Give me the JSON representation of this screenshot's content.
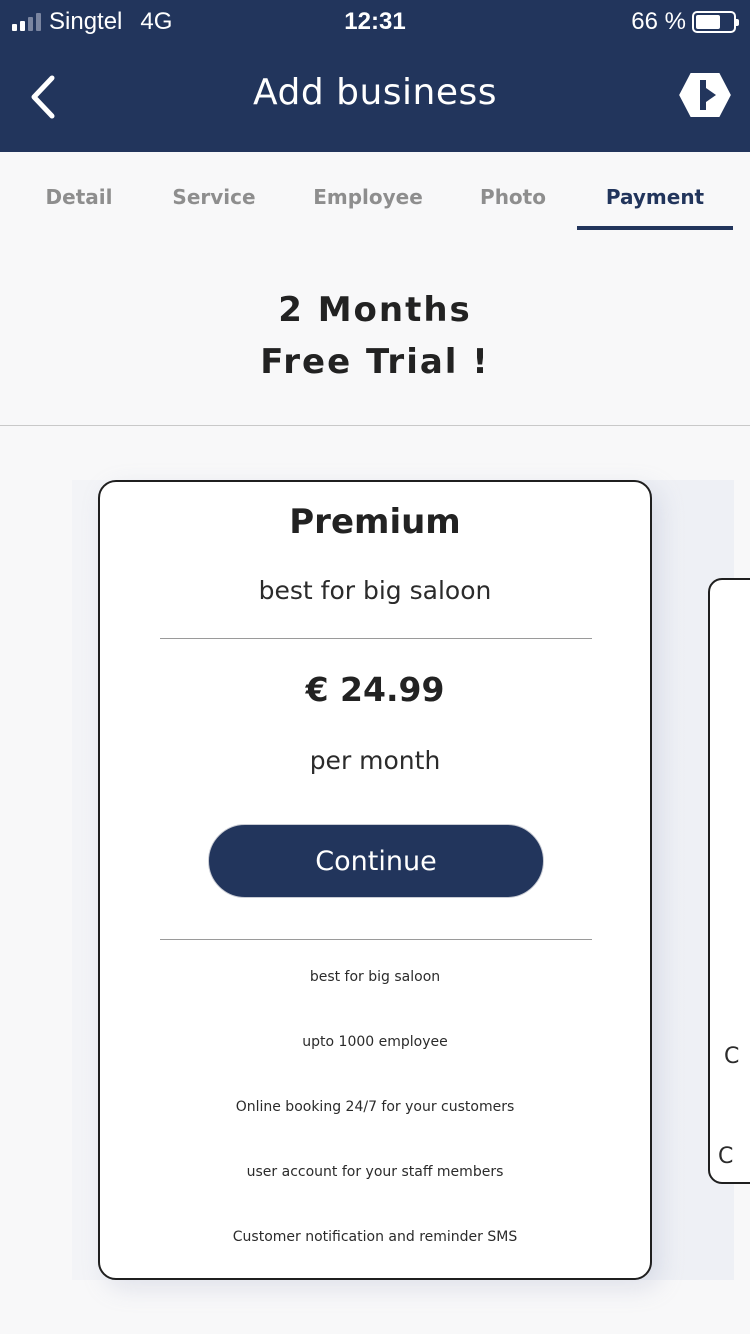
{
  "status_bar": {
    "carrier": "Singtel",
    "network": "4G",
    "time": "12:31",
    "battery": "66 %",
    "battery_level": 0.66
  },
  "nav": {
    "title": "Add business",
    "back_icon": "chevron-left-icon",
    "logo_icon": "brand-logo-icon"
  },
  "tabs": [
    {
      "label": "Detail",
      "active": false
    },
    {
      "label": "Service",
      "active": false
    },
    {
      "label": "Employee",
      "active": false
    },
    {
      "label": "Photo",
      "active": false
    },
    {
      "label": "Payment",
      "active": true
    }
  ],
  "headline": {
    "line1": "2 Months",
    "line2": "Free Trial !"
  },
  "plan": {
    "title": "Premium",
    "subtitle": "best for big saloon",
    "price": "€ 24.99",
    "period": "per month",
    "cta": "Continue",
    "features": [
      "best for big saloon",
      "upto 1000 employee",
      "Online booking 24/7 for your customers",
      "user account for your staff members",
      "Customer notification and reminder SMS"
    ]
  },
  "next_plan_peek": {
    "glyphs": [
      "C",
      "C"
    ]
  },
  "colors": {
    "primary": "#22355c",
    "background": "#f8f8f9",
    "tab_inactive": "#8e8e8e"
  }
}
